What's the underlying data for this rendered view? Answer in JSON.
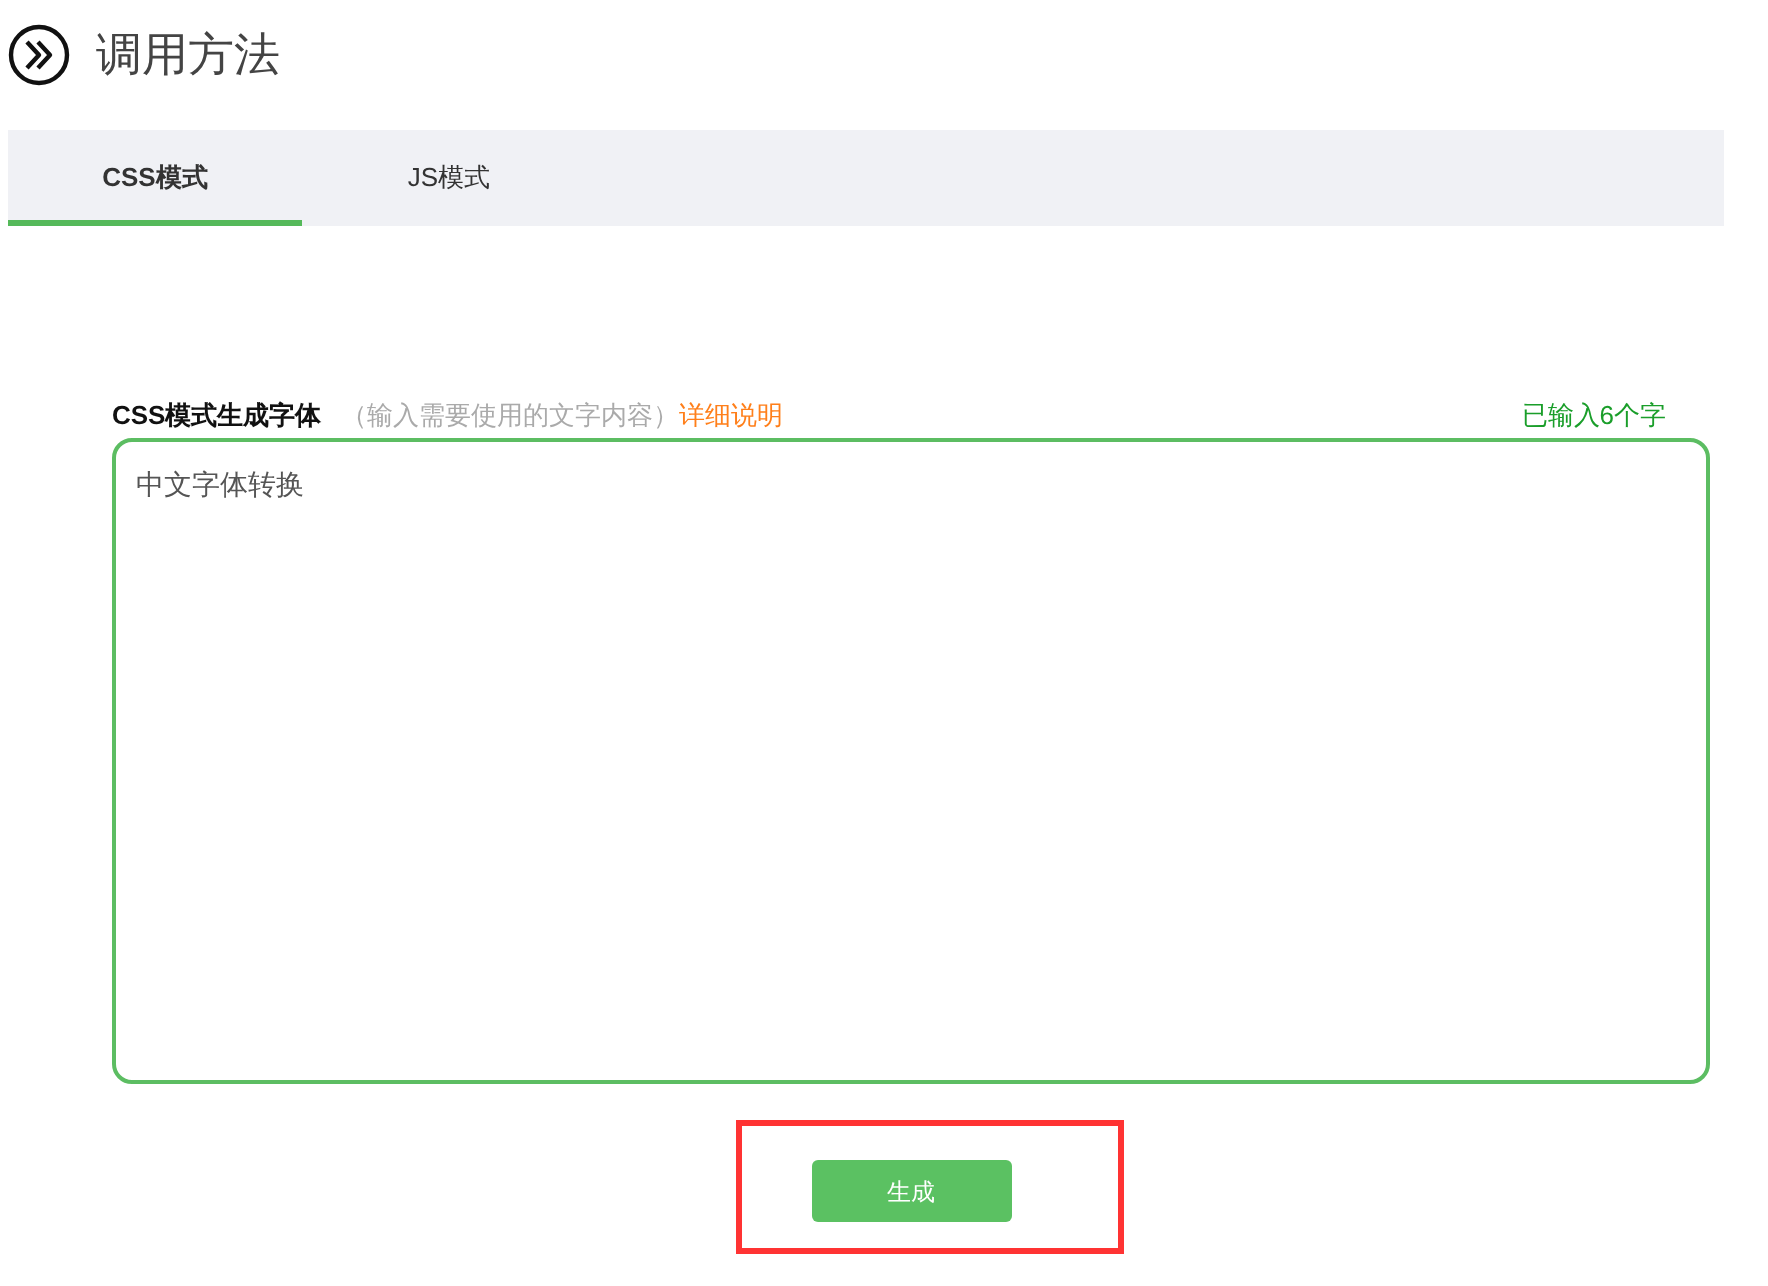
{
  "header": {
    "title": "调用方法"
  },
  "tabs": [
    {
      "label": "CSS模式",
      "selected": true
    },
    {
      "label": "JS模式",
      "selected": false
    }
  ],
  "form": {
    "title": "CSS模式生成字体",
    "hint": "（输入需要使用的文字内容）",
    "help_link": "详细说明",
    "counter": "已输入6个字",
    "text_area": {
      "value": "中文字体转换"
    }
  },
  "generate_button": {
    "label": "生成",
    "highlighted": true
  }
}
